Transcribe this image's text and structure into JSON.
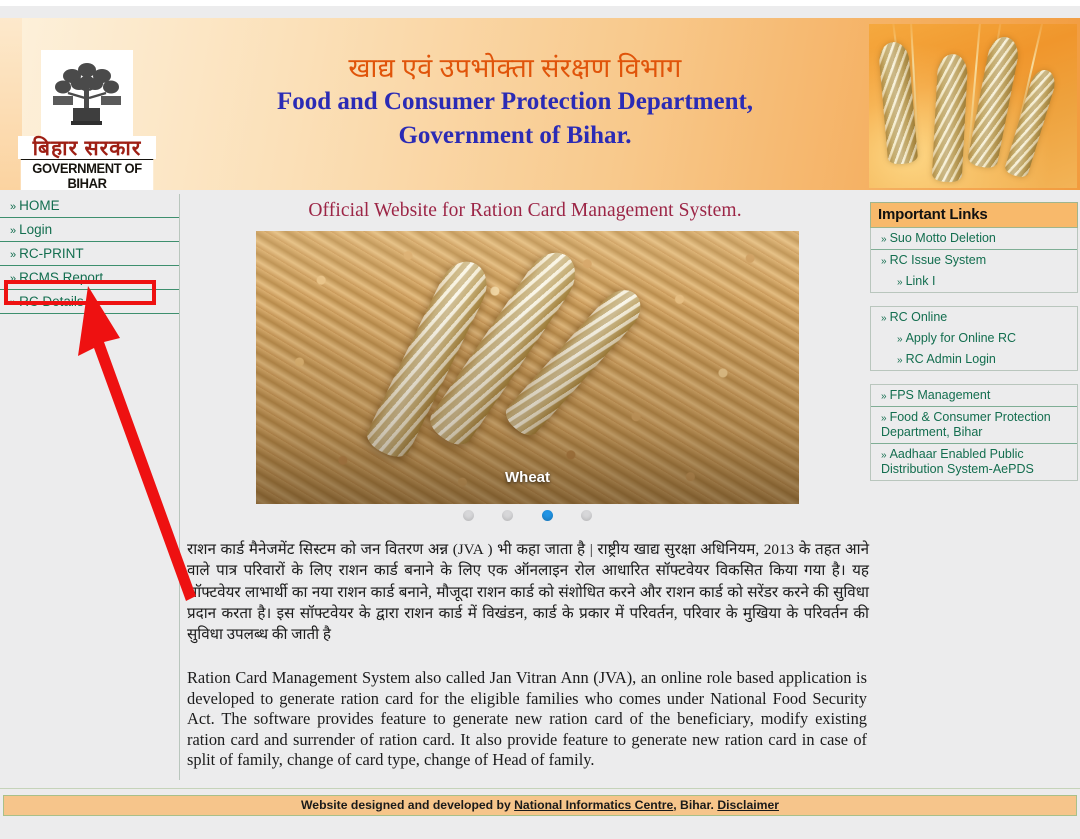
{
  "header": {
    "logo": {
      "emblem_name": "bihar-government-emblem",
      "hindi_text": "बिहार सरकार",
      "english_text": "GOVERNMENT OF BIHAR"
    },
    "title_hindi": "खाद्य एवं उपभोक्ता संरक्षण विभाग",
    "title_english_line1": "Food and Consumer Protection Department,",
    "title_english_line2": "Government of Bihar.",
    "banner_image_name": "wheat-ears-banner"
  },
  "left_nav": {
    "items": [
      {
        "label": "HOME",
        "highlighted": false
      },
      {
        "label": "Login",
        "highlighted": false
      },
      {
        "label": "RC-PRINT",
        "highlighted": false
      },
      {
        "label": "RCMS Report",
        "highlighted": true
      },
      {
        "label": "RC Details",
        "highlighted": false
      }
    ]
  },
  "main": {
    "page_title": "Official Website for Ration Card Management System.",
    "carousel": {
      "caption": "Wheat",
      "slide_image_name": "wheat-grain-slide",
      "dots": 4,
      "active_dot": 3
    },
    "paragraph_hindi": "राशन कार्ड मैनेजमेंट सिस्टम को जन वितरण अन्न (JVA ) भी कहा जाता है | राष्ट्रीय खाद्य सुरक्षा अधिनियम, 2013 के तहत आने वाले पात्र परिवारों के लिए राशन कार्ड बनाने के लिए एक ऑनलाइन रोल आधारित सॉफ्टवेयर विकसित किया गया है। यह सॉफ्टवेयर लाभार्थी का नया राशन कार्ड बनाने, मौजूदा राशन कार्ड को संशोधित करने और राशन कार्ड को सरेंडर करने की सुविधा प्रदान करता है। इस सॉफ्टवेयर के द्वारा राशन कार्ड में विखंडन, कार्ड के प्रकार में परिवर्तन, परिवार के मुखिया के परिवर्तन की सुविधा उपलब्ध की जाती है",
    "paragraph_english": "Ration Card Management System also called Jan Vitran Ann (JVA), an online role based application is developed to generate ration card for the eligible families who comes under National Food Security Act. The software provides feature to generate new ration card of the beneficiary, modify existing ration card and surrender of ration card. It also provide feature to generate new ration card in case of split of family, change of card type, change of Head of family."
  },
  "right_links": {
    "header": "Important Links",
    "groups": [
      {
        "items": [
          {
            "label": "Suo Motto Deletion",
            "sub": false
          },
          {
            "label": "RC Issue System",
            "sub": false
          },
          {
            "label": "Link I",
            "sub": true
          }
        ]
      },
      {
        "items": [
          {
            "label": "RC Online",
            "sub": false
          },
          {
            "label": "Apply for Online RC",
            "sub": true
          },
          {
            "label": "RC Admin Login",
            "sub": true
          }
        ]
      },
      {
        "items": [
          {
            "label": "FPS Management",
            "sub": false
          }
        ]
      },
      {
        "items": [
          {
            "label": "Food & Consumer Protection Department, Bihar",
            "sub": false
          }
        ]
      },
      {
        "items": [
          {
            "label": "Aadhaar Enabled Public Distribution System-AePDS",
            "sub": false
          }
        ]
      }
    ]
  },
  "footer": {
    "prefix": "Website designed and developed by ",
    "link1": "National Informatics Centre",
    "middle": ", Bihar. ",
    "link2": "Disclaimer"
  },
  "annotations": {
    "highlight_box_target": "RCMS Report",
    "arrow_color": "#ee1111",
    "box_color": "#ee1111"
  },
  "colors": {
    "nav_link": "#136e4f",
    "header_bar": "#f8b96b",
    "title_hindi": "#e0540a",
    "title_english": "#2b2bb5",
    "page_title": "#9c2546",
    "active_dot": "#2196e8",
    "footer_bg": "#f6c58b"
  }
}
